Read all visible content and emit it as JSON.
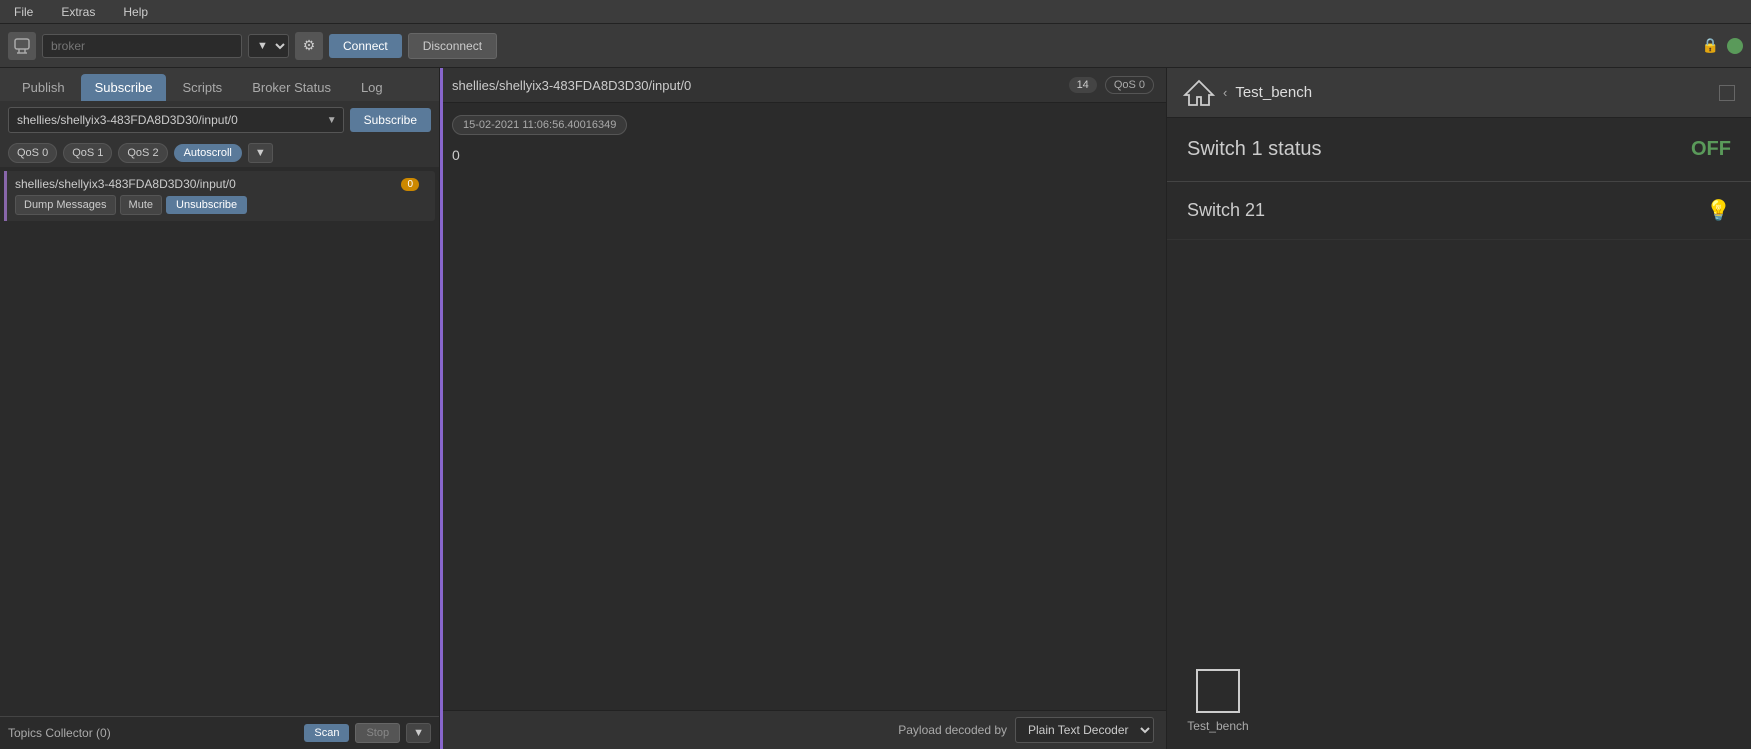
{
  "menu": {
    "file": "File",
    "extras": "Extras",
    "help": "Help"
  },
  "connection": {
    "broker_placeholder": "broker",
    "connect_label": "Connect",
    "disconnect_label": "Disconnect"
  },
  "tabs": {
    "publish": "Publish",
    "subscribe": "Subscribe",
    "scripts": "Scripts",
    "broker_status": "Broker Status",
    "log": "Log"
  },
  "subscribe": {
    "topic_value": "shellies/shellyix3-483FDA8D3D30/input/0",
    "subscribe_btn": "Subscribe",
    "qos0": "QoS 0",
    "qos1": "QoS 1",
    "qos2": "QoS 2",
    "autoscroll": "Autoscroll"
  },
  "subscription_item": {
    "topic": "shellies/shellyix3-483FDA8D3D30/input/0",
    "badge": "0",
    "dump_btn": "Dump Messages",
    "mute_btn": "Mute",
    "unsub_btn": "Unsubscribe"
  },
  "topics_collector": {
    "label": "Topics Collector (0)",
    "scan_btn": "Scan",
    "stop_btn": "Stop"
  },
  "message_panel": {
    "topic": "shellies/shellyix3-483FDA8D3D30/input/0",
    "count": "14",
    "qos": "QoS 0",
    "timestamp": "15-02-2021  11:06:56.40016349",
    "value": "0"
  },
  "payload": {
    "label": "Payload decoded by",
    "decoder_label": "Plain Text Decoder"
  },
  "dashboard": {
    "back_arrow": "‹",
    "title": "Test_bench",
    "switch_status_label": "Switch 1 status",
    "switch_status_value": "OFF",
    "switch21_label": "Switch 21",
    "testbench_icon_label": "Test_bench"
  }
}
